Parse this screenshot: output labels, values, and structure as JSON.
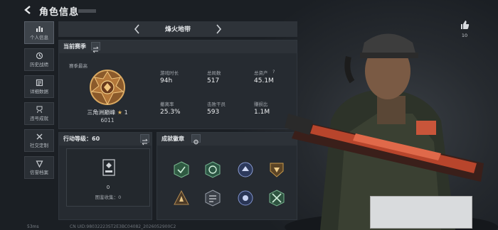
{
  "header": {
    "title": "角色信息"
  },
  "side_nav": [
    {
      "label": "个人信息",
      "icon": "bar-chart-icon",
      "active": true
    },
    {
      "label": "历史战绩",
      "icon": "history-icon"
    },
    {
      "label": "详细数据",
      "icon": "data-sheet-icon"
    },
    {
      "label": "违号成就",
      "icon": "achievement-icon"
    },
    {
      "label": "社交定制",
      "icon": "social-tools-icon"
    },
    {
      "label": "信誉档案",
      "icon": "reputation-icon"
    }
  ],
  "map_selector": {
    "current": "烽火地带"
  },
  "season": {
    "title": "当前赛季",
    "best_label": "赛季最高",
    "rank_name": "三角洲巅峰",
    "rank_star": "1",
    "rank_score": "6011",
    "stats": [
      {
        "label": "游戏时长",
        "value": "94h"
      },
      {
        "label": "总局数",
        "value": "517"
      },
      {
        "label": "总资产",
        "value": "45.1M",
        "has_help": true
      },
      {
        "label": "撤离率",
        "value": "25.3%"
      },
      {
        "label": "击败干员",
        "value": "593"
      },
      {
        "label": "赚损比",
        "value": "1.1M"
      }
    ]
  },
  "action_level": {
    "title": "行动等级：",
    "level": "60",
    "codex_count": "0",
    "codex_label": "图鉴收集：0"
  },
  "achievements": {
    "title": "成就徽章"
  },
  "likes": {
    "count": "10"
  },
  "footer": {
    "ping": "53ms",
    "uid": "CN UID:98032223ST2E3BC04082_2026052900C2"
  },
  "colors": {
    "accent": "#e2e5e8",
    "panel": "#262b31",
    "gold": "#c99a4a"
  }
}
